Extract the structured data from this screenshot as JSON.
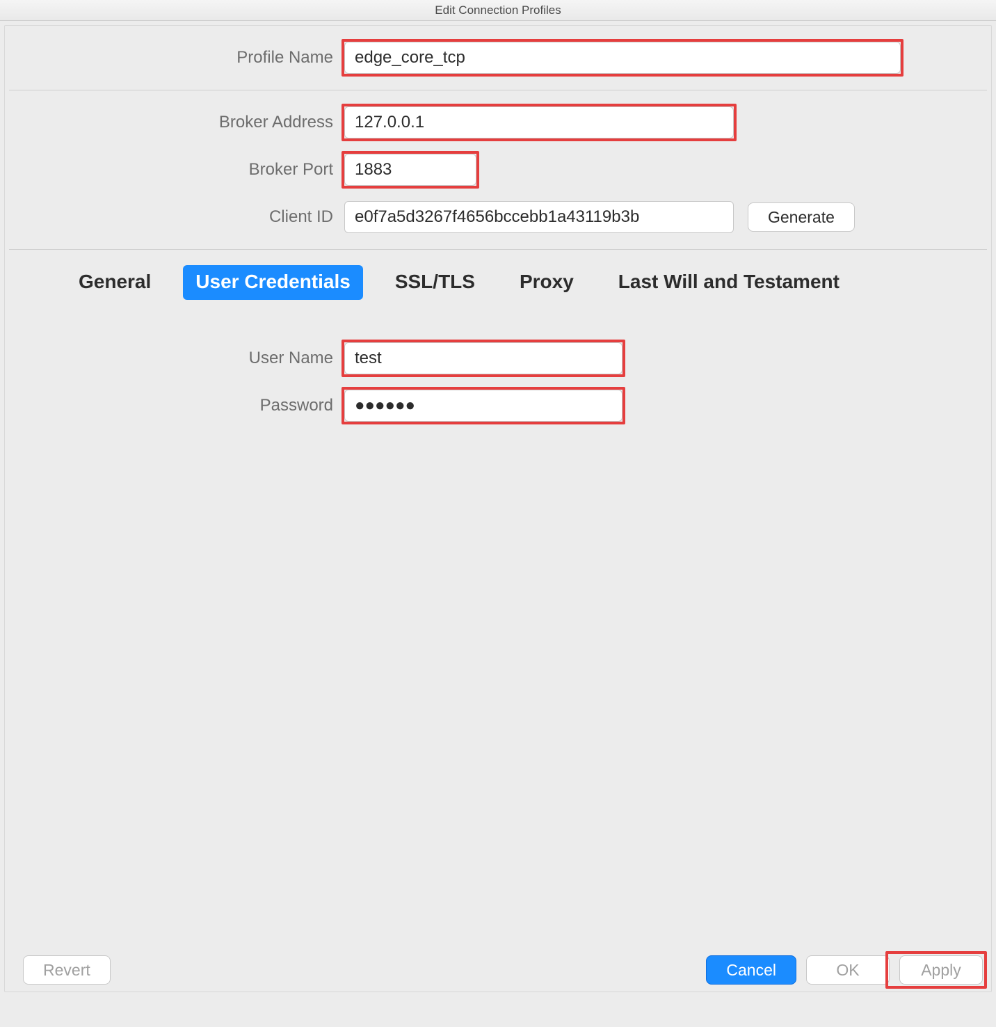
{
  "window": {
    "title": "Edit Connection Profiles"
  },
  "labels": {
    "profile_name": "Profile Name",
    "broker_address": "Broker Address",
    "broker_port": "Broker Port",
    "client_id": "Client ID",
    "generate": "Generate",
    "user_name": "User Name",
    "password": "Password"
  },
  "values": {
    "profile_name": "edge_core_tcp",
    "broker_address": "127.0.0.1",
    "broker_port": "1883",
    "client_id": "e0f7a5d3267f4656bccebb1a43119b3b",
    "user_name": "test",
    "password": "●●●●●●"
  },
  "tabs": [
    {
      "label": "General",
      "active": false
    },
    {
      "label": "User Credentials",
      "active": true
    },
    {
      "label": "SSL/TLS",
      "active": false
    },
    {
      "label": "Proxy",
      "active": false
    },
    {
      "label": "Last Will and Testament",
      "active": false
    }
  ],
  "footer": {
    "revert": "Revert",
    "cancel": "Cancel",
    "ok": "OK",
    "apply": "Apply"
  },
  "colors": {
    "accent": "#1b8cff",
    "highlight": "#e53e3e"
  }
}
